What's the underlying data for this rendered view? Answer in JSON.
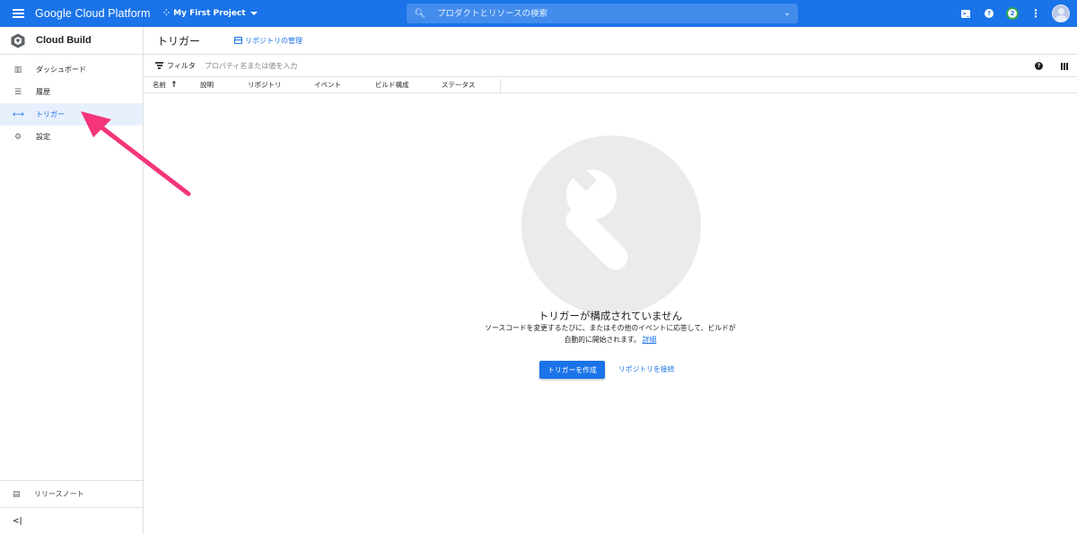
{
  "topbar": {
    "brand": "Google Cloud Platform",
    "project": "My First Project",
    "search_placeholder": "プロダクトとリソースの検索",
    "notification_count": "2",
    "colors": {
      "bar": "#1a73e8",
      "accent_green": "#34a853"
    }
  },
  "sidebar": {
    "product": "Cloud Build",
    "items": [
      {
        "label": "ダッシュボード",
        "icon": "dashboard-icon"
      },
      {
        "label": "履歴",
        "icon": "list-icon"
      },
      {
        "label": "トリガー",
        "icon": "arrow-icon",
        "active": true
      },
      {
        "label": "設定",
        "icon": "gear-icon"
      }
    ],
    "release_notes": "リリースノート",
    "collapse": "<|"
  },
  "page": {
    "title": "トリガー",
    "manage_repos": "リポジトリの管理"
  },
  "filter": {
    "label": "フィルタ",
    "placeholder": "プロパティ名または値を入力"
  },
  "table": {
    "columns": [
      "名前",
      "説明",
      "リポジトリ",
      "イベント",
      "ビルド構成",
      "ステータス"
    ],
    "sort_indicator": "↑"
  },
  "empty_state": {
    "title": "トリガーが構成されていません",
    "desc_line1": "ソースコードを変更するたびに、またはその他のイベントに応答して、ビルドが",
    "desc_line2": "自動的に開始されます。",
    "details_link": "詳細",
    "create_button": "トリガーを作成",
    "connect_link": "リポジトリを接続"
  },
  "annotation": {
    "color": "#f5357a"
  }
}
